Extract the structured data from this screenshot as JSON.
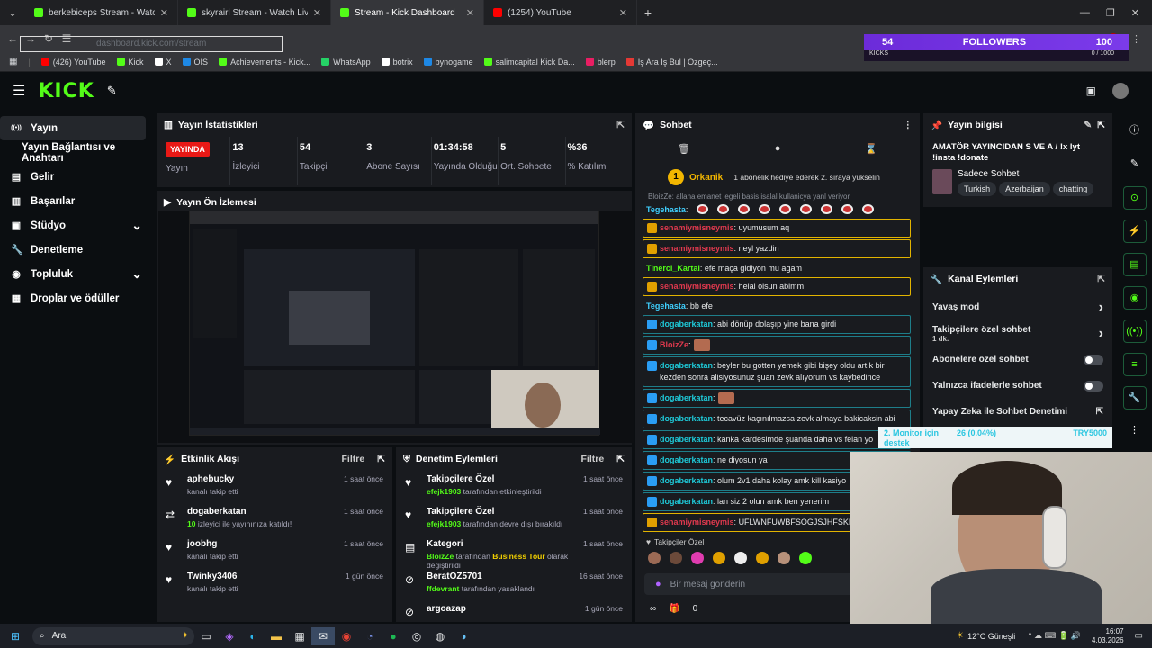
{
  "browser": {
    "tabs": [
      {
        "title": "berkebiceps Stream - Watch Li...",
        "color": "#53fc18"
      },
      {
        "title": "skyrairl Stream - Watch Live on",
        "color": "#53fc18"
      },
      {
        "title": "Stream - Kick Dashboard",
        "color": "#53fc18",
        "active": true
      },
      {
        "title": "(1254) YouTube",
        "color": "#ff0000"
      }
    ],
    "new_tab": "+",
    "url": "dashboard.kick.com/stream",
    "bookmarks": [
      {
        "label": "(426) YouTube",
        "color": "#ff0000"
      },
      {
        "label": "Kick",
        "color": "#53fc18"
      },
      {
        "label": "X",
        "color": "#ffffff"
      },
      {
        "label": "OIS",
        "color": "#1e88e5"
      },
      {
        "label": "Achievements - Kick...",
        "color": "#53fc18"
      },
      {
        "label": "WhatsApp",
        "color": "#25d366"
      },
      {
        "label": "botrix",
        "color": "#ffffff"
      },
      {
        "label": "bynogame",
        "color": "#1e88e5"
      },
      {
        "label": "salimcapital Kick Da...",
        "color": "#53fc18"
      },
      {
        "label": "blerp",
        "color": "#e91e63"
      },
      {
        "label": "İş Ara İş Bul | Özgeç...",
        "color": "#e53935"
      }
    ]
  },
  "overlay": {
    "followers_count": "54",
    "followers_label": "FOLLOWERS",
    "followers_goal": "100",
    "kicks_label": "KICKS",
    "kicks_value": "0 / 1000"
  },
  "sidebar": {
    "items": [
      {
        "label": "Yayın",
        "icon": "broadcast-icon",
        "active": true
      },
      {
        "label": "Yayın Bağlantısı ve Anahtarı"
      },
      {
        "label": "Gelir",
        "icon": "wallet-icon"
      },
      {
        "label": "Başarılar",
        "icon": "trophy-icon"
      },
      {
        "label": "Stüdyo",
        "icon": "studio-icon",
        "chev": true
      },
      {
        "label": "Denetleme",
        "icon": "wrench-icon"
      },
      {
        "label": "Topluluk",
        "icon": "community-icon",
        "chev": true
      },
      {
        "label": "Droplar ve ödüller",
        "icon": "gift-icon"
      }
    ]
  },
  "stats": {
    "title": "Yayın İstatistikleri",
    "live_badge": "YAYINDA",
    "items": [
      {
        "value": "",
        "label": "Yayın"
      },
      {
        "value": "13",
        "label": "İzleyici"
      },
      {
        "value": "54",
        "label": "Takipçi"
      },
      {
        "value": "3",
        "label": "Abone Sayısı"
      },
      {
        "value": "01:34:58",
        "label": "Yayında Olduğu"
      },
      {
        "value": "5",
        "label": "Ort. Sohbete"
      },
      {
        "value": "%36",
        "label": "% Katılım"
      }
    ]
  },
  "preview": {
    "title": "Yayın Ön İzlemesi"
  },
  "activity": {
    "title": "Etkinlik Akışı",
    "filter": "Filtre",
    "items": [
      {
        "name": "aphebucky",
        "desc": "kanalı takip etti",
        "time": "1 saat önce",
        "icon": "heart-icon"
      },
      {
        "name": "dogaberkatan",
        "count": "10",
        "desc": " izleyici ile yayınınıza katıldı!",
        "time": "1 saat önce",
        "icon": "raid-icon"
      },
      {
        "name": "joobhg",
        "desc": "kanalı takip etti",
        "time": "1 saat önce",
        "icon": "heart-icon"
      },
      {
        "name": "Twinky3406",
        "desc": "kanalı takip etti",
        "time": "1 gün önce",
        "icon": "heart-icon"
      }
    ]
  },
  "moderation": {
    "title": "Denetim Eylemleri",
    "filter": "Filtre",
    "items": [
      {
        "name": "Takipçilere Özel",
        "who": "efejk1903",
        "desc": " tarafından etkinleştirildi",
        "time": "1 saat önce",
        "icon": "heart-icon"
      },
      {
        "name": "Takipçilere Özel",
        "who": "efejk1903",
        "desc": " tarafından devre dışı bırakıldı",
        "time": "1 saat önce",
        "icon": "heart-icon"
      },
      {
        "name": "Kategori",
        "who": "BloizZe",
        "desc": " tarafından ",
        "extra": "Business Tour",
        "desc2": " olarak değiştirildi",
        "time": "1 saat önce",
        "icon": "category-icon"
      },
      {
        "name": "BeratOZ5701",
        "who": "ffdevrant",
        "desc": " tarafından yasaklandı",
        "time": "16 saat önce",
        "icon": "ban-icon"
      },
      {
        "name": "argoazap",
        "time": "1 gün önce",
        "icon": "ban-icon"
      }
    ]
  },
  "chat": {
    "title": "Sohbet",
    "pinned_user": "Orkanik",
    "pinned_count": "1",
    "pinned_text": "1 abonelik hediye ederek 2. sıraya yükselin",
    "partial_line": "BloizZe: allaha emanet legeli basis isalal kullanicya yanl veriyor",
    "messages": [
      {
        "user": "Tegehasta",
        "color": "#3fd0ff",
        "text": "",
        "style": "",
        "emotes": 9
      },
      {
        "user": "senamiymisneymis",
        "color": "#e0394e",
        "text": "uyumusum aq",
        "style": "sub"
      },
      {
        "user": "senamiymisneymis",
        "color": "#e0394e",
        "text": "neyl yazdin",
        "style": "sub"
      },
      {
        "user": "Tinerci_Kartal",
        "color": "#53fc18",
        "text": "efe maça gidiyon mu agam",
        "style": ""
      },
      {
        "user": "senamiymisneymis",
        "color": "#e0394e",
        "text": "helal olsun abimm",
        "style": "sub"
      },
      {
        "user": "Tegehasta",
        "color": "#3fd0ff",
        "text": "bb efe",
        "style": ""
      },
      {
        "user": "dogaberkatan",
        "color": "#1ec9d8",
        "text": "abi dönüp dolaşıp yine bana girdi",
        "style": "bot"
      },
      {
        "user": "BloizZe",
        "color": "#e0394e",
        "text": "",
        "style": "bot",
        "emote": true
      },
      {
        "user": "dogaberkatan",
        "color": "#1ec9d8",
        "text": "beyler bu gotten yemek gibi bişey oldu artık bir kezden sonra alisiyosunuz şuan zevk alıyorum vs kaybedince",
        "style": "bot"
      },
      {
        "user": "dogaberkatan",
        "color": "#1ec9d8",
        "text": "",
        "style": "bot",
        "emote": true
      },
      {
        "user": "dogaberkatan",
        "color": "#1ec9d8",
        "text": "tecavüz kaçınılmazsa zevk almaya bakicaksin abi",
        "style": "bot"
      },
      {
        "user": "dogaberkatan",
        "color": "#1ec9d8",
        "text": "kanka kardesimde şuanda daha vs felan yo",
        "style": "bot"
      },
      {
        "user": "dogaberkatan",
        "color": "#1ec9d8",
        "text": "ne diyosun ya",
        "style": "bot"
      },
      {
        "user": "dogaberkatan",
        "color": "#1ec9d8",
        "text": "olum 2v1 daha kolay amk kill kasiyo",
        "style": "bot"
      },
      {
        "user": "dogaberkatan",
        "color": "#1ec9d8",
        "text": "lan siz 2 olun amk ben yenerim",
        "style": "bot"
      },
      {
        "user": "senamiymisneymis",
        "color": "#e0394e",
        "text": "UFLWNFUWBFSOGJSJHFSKF",
        "style": "sub"
      }
    ],
    "followers_only": "Takipçiler Özel",
    "input_placeholder": "Bir mesaj gönderin",
    "points": "0"
  },
  "stream_info": {
    "title": "Yayın bilgisi",
    "stream_title": "AMATÖR YAYINCIDAN S VE A / !x lyt !insta !donate",
    "category": "Sadece Sohbet",
    "tags": [
      "Turkish",
      "Azerbaijan",
      "chatting"
    ]
  },
  "channel_actions": {
    "title": "Kanal Eylemleri",
    "items": [
      {
        "label": "Yavaş mod",
        "control": "chevron"
      },
      {
        "label": "Takipçilere özel sohbet",
        "sub": "1 dk.",
        "control": "chevron"
      },
      {
        "label": "Abonelere özel sohbet",
        "control": "toggle"
      },
      {
        "label": "Yalnızca ifadelerle sohbet",
        "control": "toggle"
      },
      {
        "label": "Yapay Zeka ile Sohbet Denetimi",
        "control": "external"
      }
    ]
  },
  "monitor_overlay": {
    "line1": "2. Monitor için",
    "line2": "destek",
    "value": "26 (0.04%)",
    "goal": "TRY5000"
  },
  "taskbar": {
    "search": "Ara",
    "weather": "12°C Güneşli",
    "time": "16:07",
    "date": "4.03.2026"
  }
}
